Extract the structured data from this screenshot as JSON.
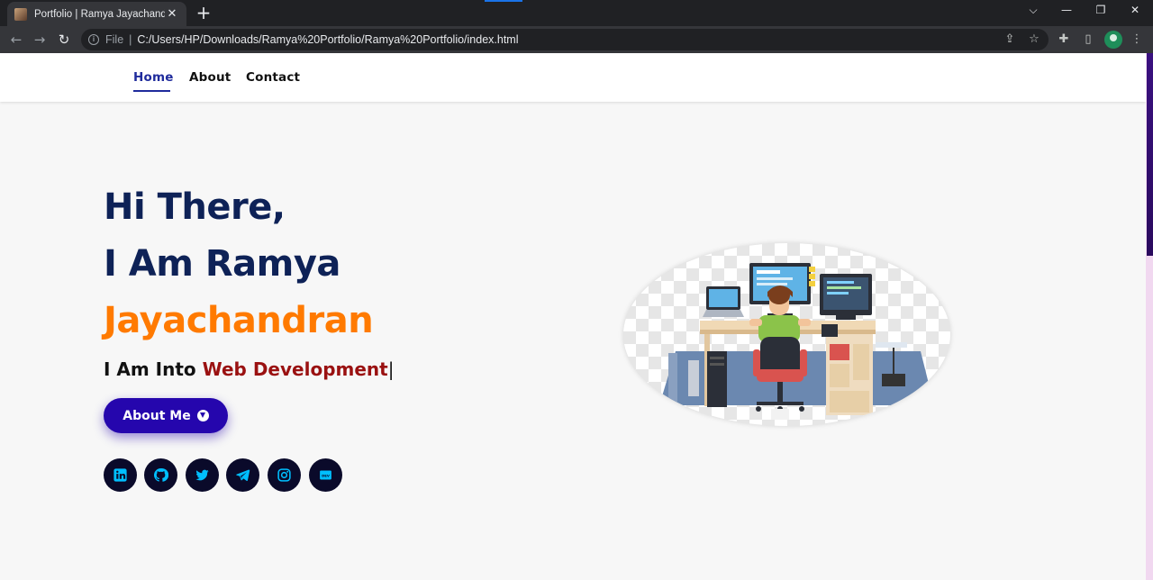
{
  "browser": {
    "tab_title": "Portfolio | Ramya Jayachandran",
    "url_scheme": "File",
    "url": "C:/Users/HP/Downloads/Ramya%20Portfolio/Ramya%20Portfolio/index.html"
  },
  "nav": {
    "items": [
      {
        "label": "Home",
        "active": true
      },
      {
        "label": "About",
        "active": false
      },
      {
        "label": "Contact",
        "active": false
      }
    ]
  },
  "hero": {
    "line1": "Hi There,",
    "line2": "I Am Ramya",
    "line3": "Jayachandran",
    "subtitle_prefix": "I Am Into ",
    "subtitle_typed": "Web Development",
    "cursor": "|",
    "button_label": "About Me"
  },
  "socials": [
    {
      "icon": "linkedin-icon"
    },
    {
      "icon": "github-icon"
    },
    {
      "icon": "twitter-icon"
    },
    {
      "icon": "telegram-icon"
    },
    {
      "icon": "instagram-icon"
    },
    {
      "icon": "dev-icon",
      "text": "DEV"
    }
  ],
  "colors": {
    "name_dark": "#0e2257",
    "name_accent": "#ff7a00",
    "typed_text": "#9a1111",
    "button_bg": "#2506ad",
    "social_icon": "#00bfff",
    "nav_active": "#1f2b9c"
  }
}
